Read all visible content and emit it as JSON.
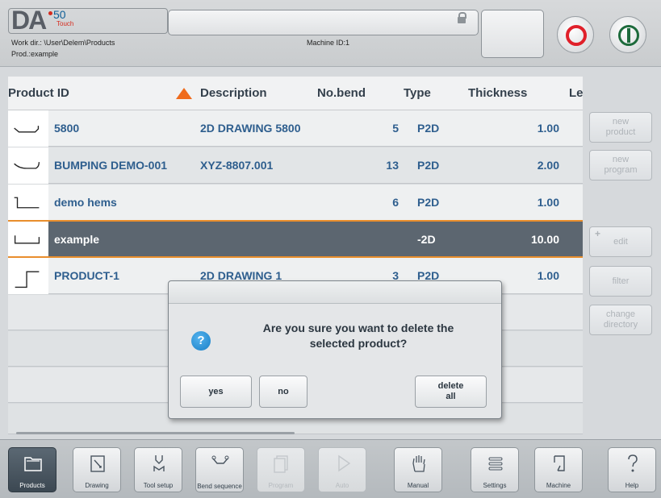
{
  "header": {
    "logo_da": "DA",
    "logo_num": "50",
    "logo_sub": "Touch",
    "work_dir": "Work dir.: \\User\\Delem\\Products",
    "machine_id": "Machine ID:1",
    "product": "Prod.:example"
  },
  "table": {
    "columns": [
      "Product ID",
      "Description",
      "No.bend",
      "Type",
      "Thickness",
      "Le"
    ],
    "rows": [
      {
        "id": "5800",
        "description": "2D DRAWING 5800",
        "bends": "5",
        "type": "P2D",
        "thickness": "1.00",
        "shape": "tray-up"
      },
      {
        "id": "BUMPING DEMO-001",
        "description": "XYZ-8807.001",
        "bends": "13",
        "type": "P2D",
        "thickness": "2.00",
        "shape": "curve"
      },
      {
        "id": "demo hems",
        "description": "",
        "bends": "6",
        "type": "P2D",
        "thickness": "1.00",
        "shape": "hem"
      },
      {
        "id": "example",
        "description": "",
        "bends": "",
        "type": "-2D",
        "thickness": "10.00",
        "shape": "channel"
      },
      {
        "id": "PRODUCT-1",
        "description": "2D DRAWING 1",
        "bends": "3",
        "type": "P2D",
        "thickness": "1.00",
        "shape": "z-step"
      }
    ]
  },
  "side_buttons": {
    "new_product": [
      "new",
      "product"
    ],
    "new_program": [
      "new",
      "program"
    ],
    "edit": "edit",
    "edit_plus": "+",
    "filter": "filter",
    "change_directory": [
      "change",
      "directory"
    ]
  },
  "dialog": {
    "icon": "?",
    "message_line1": "Are you sure you want to delete the",
    "message_line2": "selected product?",
    "yes": "yes",
    "no": "no",
    "delete_all": [
      "delete",
      "all"
    ]
  },
  "bottom_nav": [
    {
      "label": "Products",
      "icon": "folder-icon",
      "state": "active"
    },
    {
      "label": "Drawing",
      "icon": "drawing-icon",
      "state": "normal"
    },
    {
      "label": "Tool setup",
      "icon": "tool-setup-icon",
      "state": "normal"
    },
    {
      "label": "Bend sequence",
      "icon": "bend-sequence-icon",
      "state": "normal"
    },
    {
      "label": "Program",
      "icon": "program-icon",
      "state": "disabled"
    },
    {
      "label": "Auto",
      "icon": "play-icon",
      "state": "disabled"
    },
    {
      "label": "Manual",
      "icon": "hand-icon",
      "state": "normal"
    },
    {
      "label": "Settings",
      "icon": "settings-icon",
      "state": "normal"
    },
    {
      "label": "Machine",
      "icon": "machine-icon",
      "state": "normal"
    },
    {
      "label": "Help",
      "icon": "help-icon",
      "state": "normal"
    }
  ],
  "colors": {
    "accent_orange": "#ef6b1c",
    "selected_row": "#5c6670",
    "link_blue": "#2e5e8e",
    "stop_red": "#e0202a",
    "start_green": "#1d6b3c"
  }
}
